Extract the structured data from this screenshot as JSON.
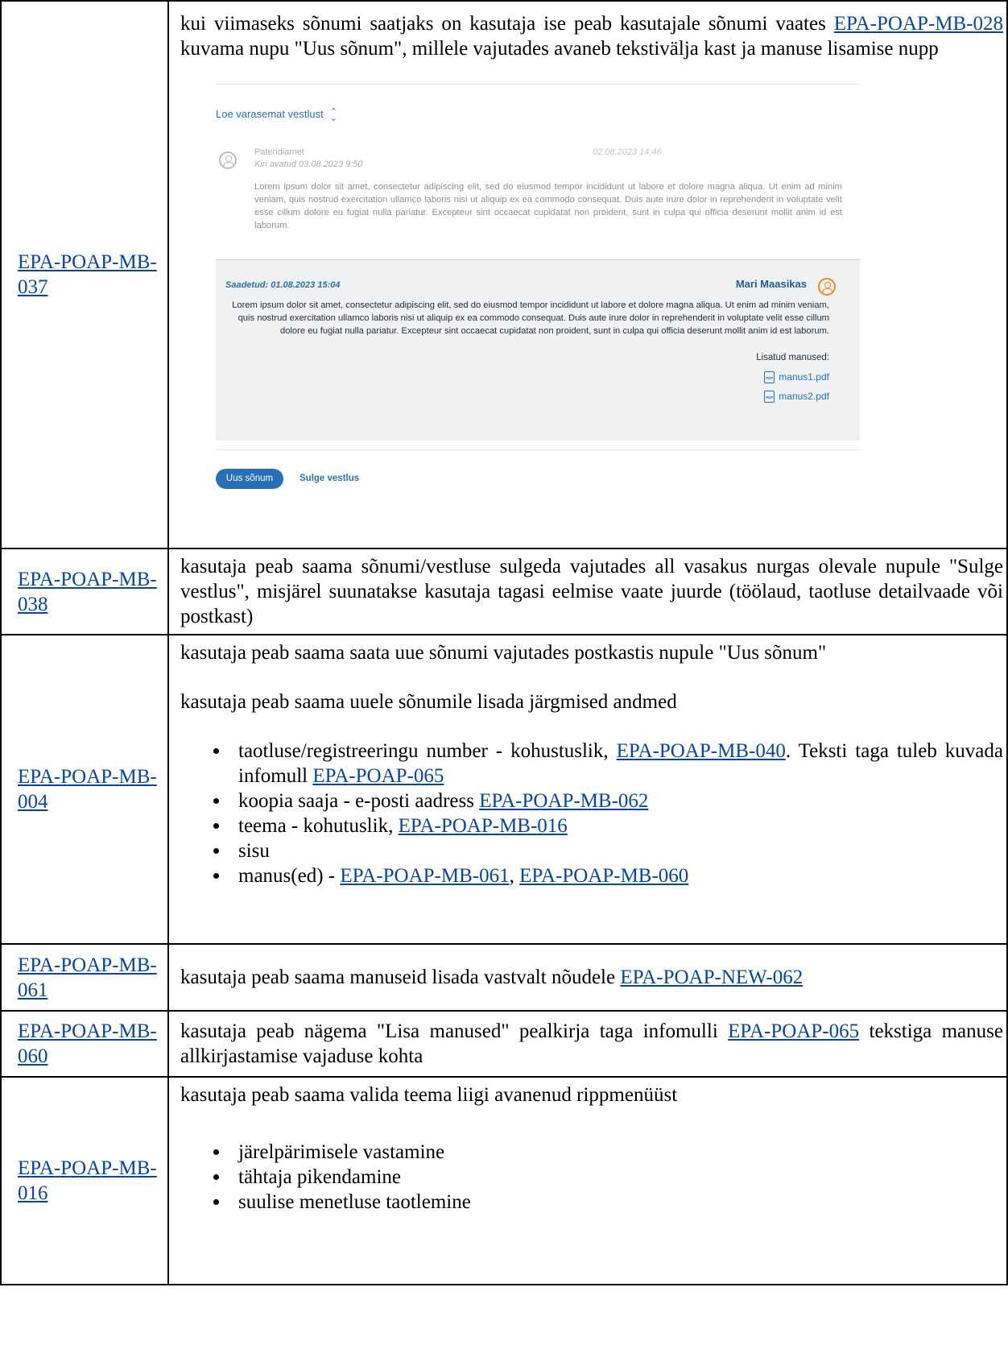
{
  "rows": {
    "r037": {
      "id": "EPA-POAP-MB-037",
      "text_before": "kui viimaseks sõnumi saatjaks on kasutaja ise peab kasutajale sõnumi vaates ",
      "link": "EPA-POAP-MB-028",
      "text_after": " kuvama nupu \"Uus sõnum\", millele vajutades avaneb tekstivälja kast ja manuse lisamise nupp",
      "screenshot": {
        "older_link": "Loe varasemat vestlust",
        "msg1": {
          "sender": "Patendiamet",
          "opened": "Kiri avatud 03.08.2023 9:50",
          "date": "02.08.2023 14:46",
          "body": "Lorem ipsum dolor sit amet, consectetur adipiscing elit, sed do eiusmod tempor incididunt ut labore et dolore magna aliqua. Ut enim ad minim veniam, quis nostrud exercitation ullamco laboris nisi ut aliquip ex ea commodo consequat. Duis aute irure dolor in reprehenderit in voluptate velit esse cillum dolore eu fugiat nulla pariatur. Excepteur sint occaecat cupidatat non proident, sunt in culpa qui officia deserunt mollit anim id est laborum."
        },
        "msg2": {
          "sent": "Saadetud: 01.08.2023 15:04",
          "sender": "Mari Maasikas",
          "body": "Lorem ipsum dolor sit amet, consectetur adipiscing elit, sed do eiusmod tempor incididunt ut labore et dolore magna aliqua. Ut enim ad minim veniam, quis nostrud exercitation ullamco laboris nisi ut aliquip ex ea commodo consequat. Duis aute irure dolor in reprehenderit in voluptate velit esse cillum dolore eu fugiat nulla pariatur. Excepteur sint occaecat cupidatat non proident, sunt in culpa qui officia deserunt mollit anim id est laborum.",
          "attachments_label": "Lisatud manused:",
          "attachments": [
            "manus1.pdf",
            "manus2.pdf"
          ],
          "pdf_icon_text": "PDF"
        },
        "new_message_button": "Uus sõnum",
        "close_chat_button": "Sulge vestlus"
      }
    },
    "r038": {
      "id": "EPA-POAP-MB-038",
      "text": "kasutaja peab saama sõnumi/vestluse sulgeda vajutades all vasakus nurgas olevale nupule \"Sulge vestlus\", misjärel suunatakse kasutaja tagasi eelmise vaate juurde (töölaud, taotluse detailvaade või postkast)"
    },
    "r004": {
      "id": "EPA-POAP-MB-004",
      "para1": "kasutaja peab saama saata uue sõnumi vajutades postkastis nupule \"Uus sõnum\"",
      "para2": "kasutaja peab saama uuele sõnumile lisada järgmised andmed",
      "b1_text": "taotluse/registreeringu number - kohustuslik, ",
      "b1_link1": "EPA-POAP-MB-040",
      "b1_text2": ". Teksti taga tuleb kuvada infomull ",
      "b1_link2": "EPA-POAP-065",
      "b2_text": "koopia saaja - e-posti aadress ",
      "b2_link": "EPA-POAP-MB-062",
      "b3_text": "teema - kohutuslik, ",
      "b3_link": "EPA-POAP-MB-016",
      "b4_text": "sisu",
      "b5_text": "manus(ed) - ",
      "b5_link1": "EPA-POAP-MB-061",
      "b5_sep": ", ",
      "b5_link2": "EPA-POAP-MB-060"
    },
    "r061": {
      "id": "EPA-POAP-MB-061",
      "text": "kasutaja peab saama manuseid lisada vastvalt nõudele ",
      "link": "EPA-POAP-NEW-062"
    },
    "r060": {
      "id": "EPA-POAP-MB-060",
      "text_before": "kasutaja peab nägema \"Lisa manused\" pealkirja taga infomulli ",
      "link": "EPA-POAP-065",
      "text_after": " tekstiga manuse allkirjastamise vajaduse kohta"
    },
    "r016": {
      "id": "EPA-POAP-MB-016",
      "para": "kasutaja peab saama valida teema liigi avanenud rippmenüüst",
      "options": [
        "järelpärimisele vastamine",
        "tähtaja pikendamine",
        "suulise menetluse taotlemine"
      ]
    }
  },
  "colors": {
    "link": "#0645ad",
    "ui_blue": "#2670b8",
    "ui_orange": "#f08a1c",
    "ui_panel": "#eff1f3"
  }
}
